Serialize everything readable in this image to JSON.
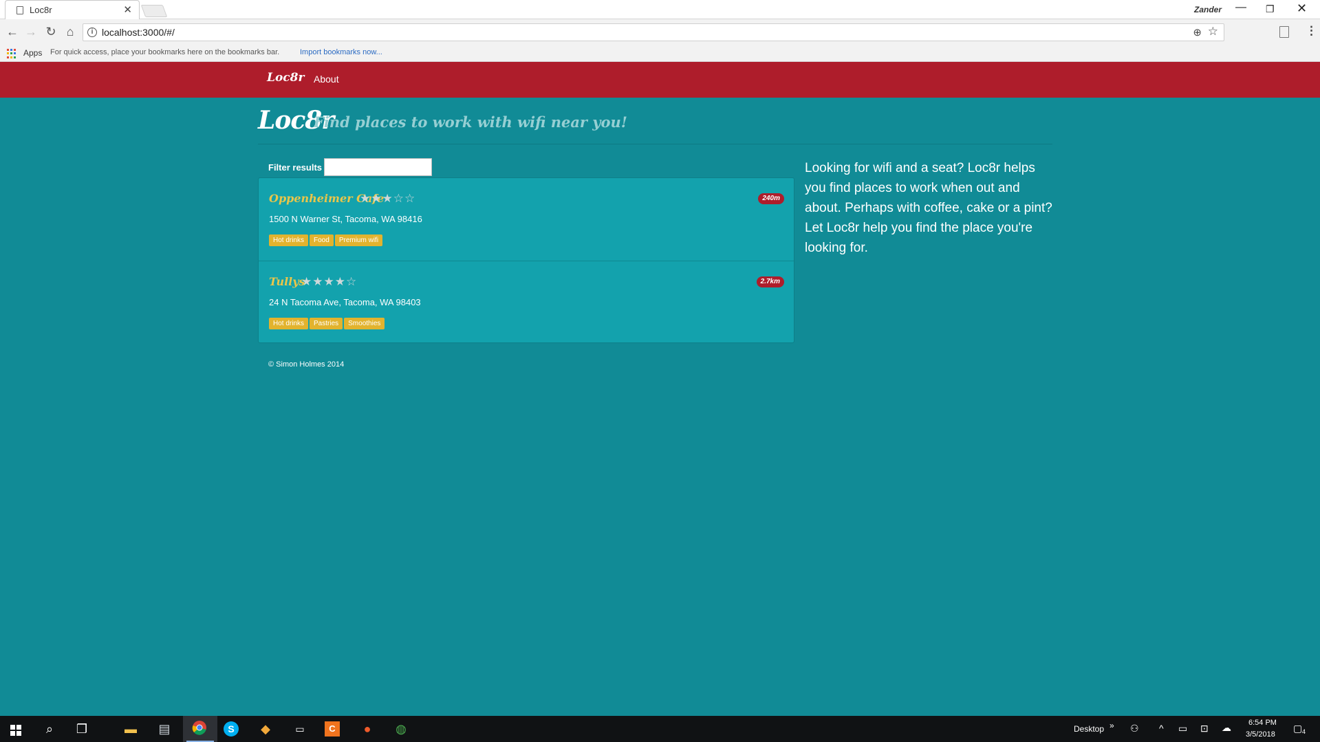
{
  "browser": {
    "tab_title": "Loc8r",
    "tab_close": "✕",
    "profile_name": "Zander",
    "url": "localhost:3000/#/",
    "bookmarks": {
      "apps_label": "Apps",
      "hint": "For quick access, place your bookmarks here on the bookmarks bar.",
      "import_link": "Import bookmarks now..."
    }
  },
  "site": {
    "navbar": {
      "brand": "Loc8r",
      "about": "About"
    },
    "header": {
      "title": "Loc8r",
      "subtitle": "Find places to work with wifi near you!"
    },
    "filter": {
      "label": "Filter results",
      "value": ""
    },
    "locations": [
      {
        "name": "Oppenheimer Cafe",
        "rating": 3,
        "stars": "★★★☆☆",
        "distance": "240m",
        "address": "1500 N Warner St, Tacoma, WA 98416",
        "facilities": [
          "Hot drinks",
          "Food",
          "Premium wifi"
        ]
      },
      {
        "name": "Tullys",
        "rating": 4,
        "stars": "★★★★☆",
        "distance": "2.7km",
        "address": "24 N Tacoma Ave, Tacoma, WA 98403",
        "facilities": [
          "Hot drinks",
          "Pastries",
          "Smoothies"
        ]
      }
    ],
    "sidebar": "Looking for wifi and a seat? Loc8r helps you find places to work when out and about. Perhaps with coffee, cake or a pint? Let Loc8r help you find the place you're looking for.",
    "footer": "© Simon Holmes 2014"
  },
  "taskbar": {
    "desktop_label": "Desktop",
    "time": "6:54 PM",
    "date": "3/5/2018",
    "notification_count": "4"
  },
  "colors": {
    "navbar": "#ae1d2b",
    "background": "#118b96",
    "list_bg": "#13a2ad",
    "name_gold": "#e9c64a",
    "facility_gold": "#e2b32e"
  }
}
